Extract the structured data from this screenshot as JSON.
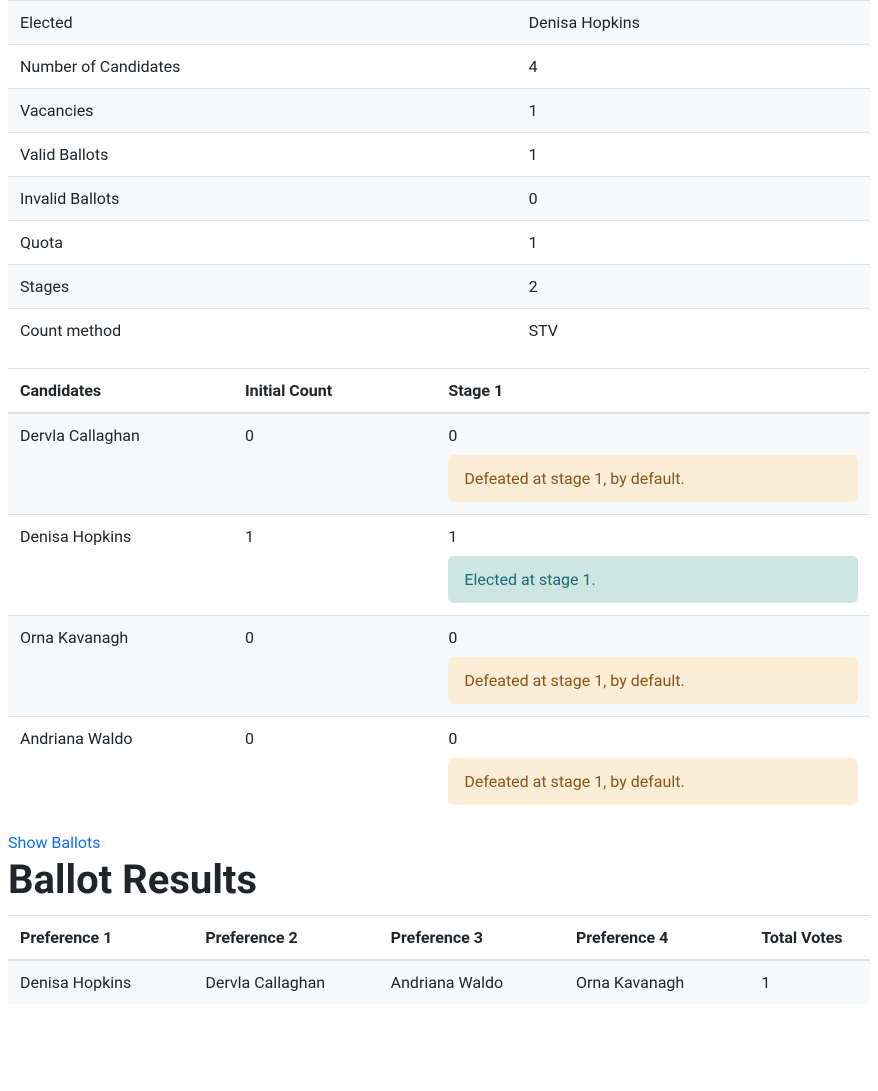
{
  "summary": {
    "rows": [
      {
        "label": "Elected",
        "value": "Denisa Hopkins"
      },
      {
        "label": "Number of Candidates",
        "value": "4"
      },
      {
        "label": "Vacancies",
        "value": "1"
      },
      {
        "label": "Valid Ballots",
        "value": "1"
      },
      {
        "label": "Invalid Ballots",
        "value": "0"
      },
      {
        "label": "Quota",
        "value": "1"
      },
      {
        "label": "Stages",
        "value": "2"
      },
      {
        "label": "Count method",
        "value": "STV"
      }
    ]
  },
  "stages": {
    "headers": [
      "Candidates",
      "Initial Count",
      "Stage 1"
    ],
    "rows": [
      {
        "name": "Dervla Callaghan",
        "initial": "0",
        "stage1": "0",
        "status": "defeated",
        "status_text": "Defeated at stage 1, by default."
      },
      {
        "name": "Denisa Hopkins",
        "initial": "1",
        "stage1": "1",
        "status": "elected",
        "status_text": "Elected at stage 1."
      },
      {
        "name": "Orna Kavanagh",
        "initial": "0",
        "stage1": "0",
        "status": "defeated",
        "status_text": "Defeated at stage 1, by default."
      },
      {
        "name": "Andriana Waldo",
        "initial": "0",
        "stage1": "0",
        "status": "defeated",
        "status_text": "Defeated at stage 1, by default."
      }
    ]
  },
  "show_ballots_link": "Show Ballots",
  "ballot_results_heading": "Ballot Results",
  "ballot_results": {
    "headers": [
      "Preference 1",
      "Preference 2",
      "Preference 3",
      "Preference 4",
      "Total Votes"
    ],
    "rows": [
      {
        "p1": "Denisa Hopkins",
        "p2": "Dervla Callaghan",
        "p3": "Andriana Waldo",
        "p4": "Orna Kavanagh",
        "total": "1"
      }
    ]
  }
}
